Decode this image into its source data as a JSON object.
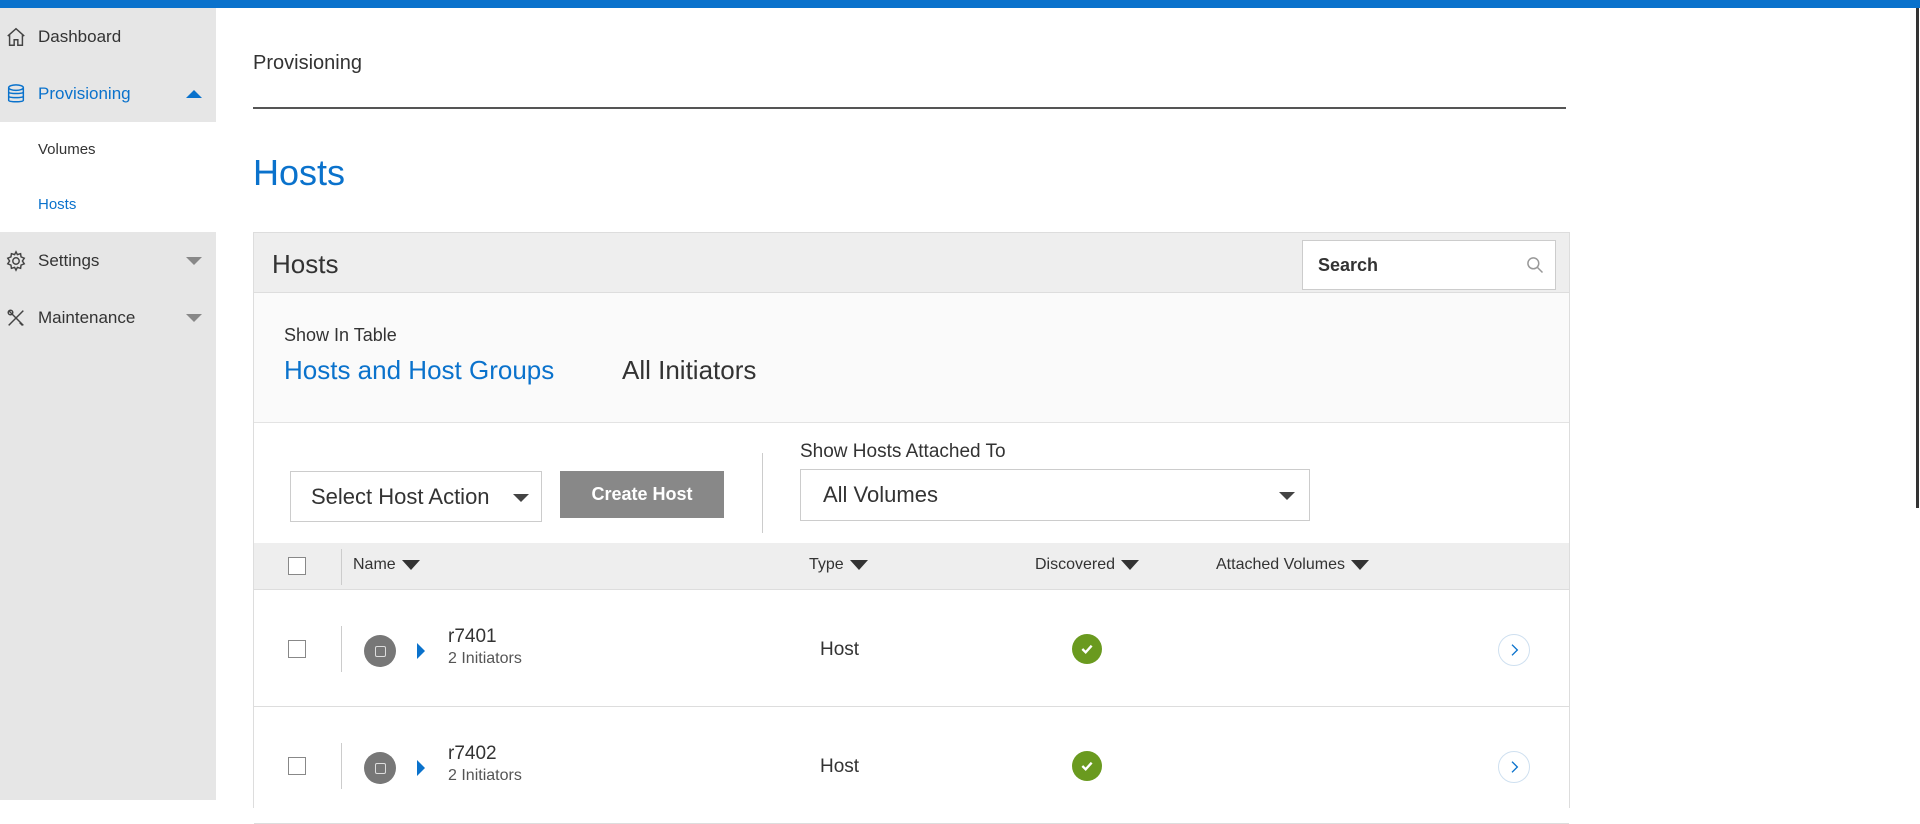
{
  "sidebar": {
    "items": [
      {
        "label": "Dashboard",
        "icon": "home-icon"
      },
      {
        "label": "Provisioning",
        "icon": "database-icon"
      },
      {
        "label": "Settings",
        "icon": "gear-icon"
      },
      {
        "label": "Maintenance",
        "icon": "tools-icon"
      }
    ],
    "subitems": [
      {
        "label": "Volumes"
      },
      {
        "label": "Hosts"
      }
    ]
  },
  "main": {
    "breadcrumb": "Provisioning",
    "title": "Hosts"
  },
  "panel": {
    "title": "Hosts",
    "search_label": "Search",
    "show_in_table": "Show In Table",
    "tabs": [
      {
        "label": "Hosts and Host Groups"
      },
      {
        "label": "All Initiators"
      }
    ],
    "select_action": "Select Host Action",
    "create_button": "Create Host",
    "attached_label": "Show Hosts Attached To",
    "attached_value": "All Volumes"
  },
  "table": {
    "columns": [
      "Name",
      "Type",
      "Discovered",
      "Attached Volumes"
    ],
    "rows": [
      {
        "name": "r7401",
        "initiators": "2 Initiators",
        "type": "Host"
      },
      {
        "name": "r7402",
        "initiators": "2 Initiators",
        "type": "Host"
      }
    ]
  },
  "colors": {
    "accent": "#0a72cc",
    "success": "#6a9a1f",
    "button_gray": "#888888"
  }
}
